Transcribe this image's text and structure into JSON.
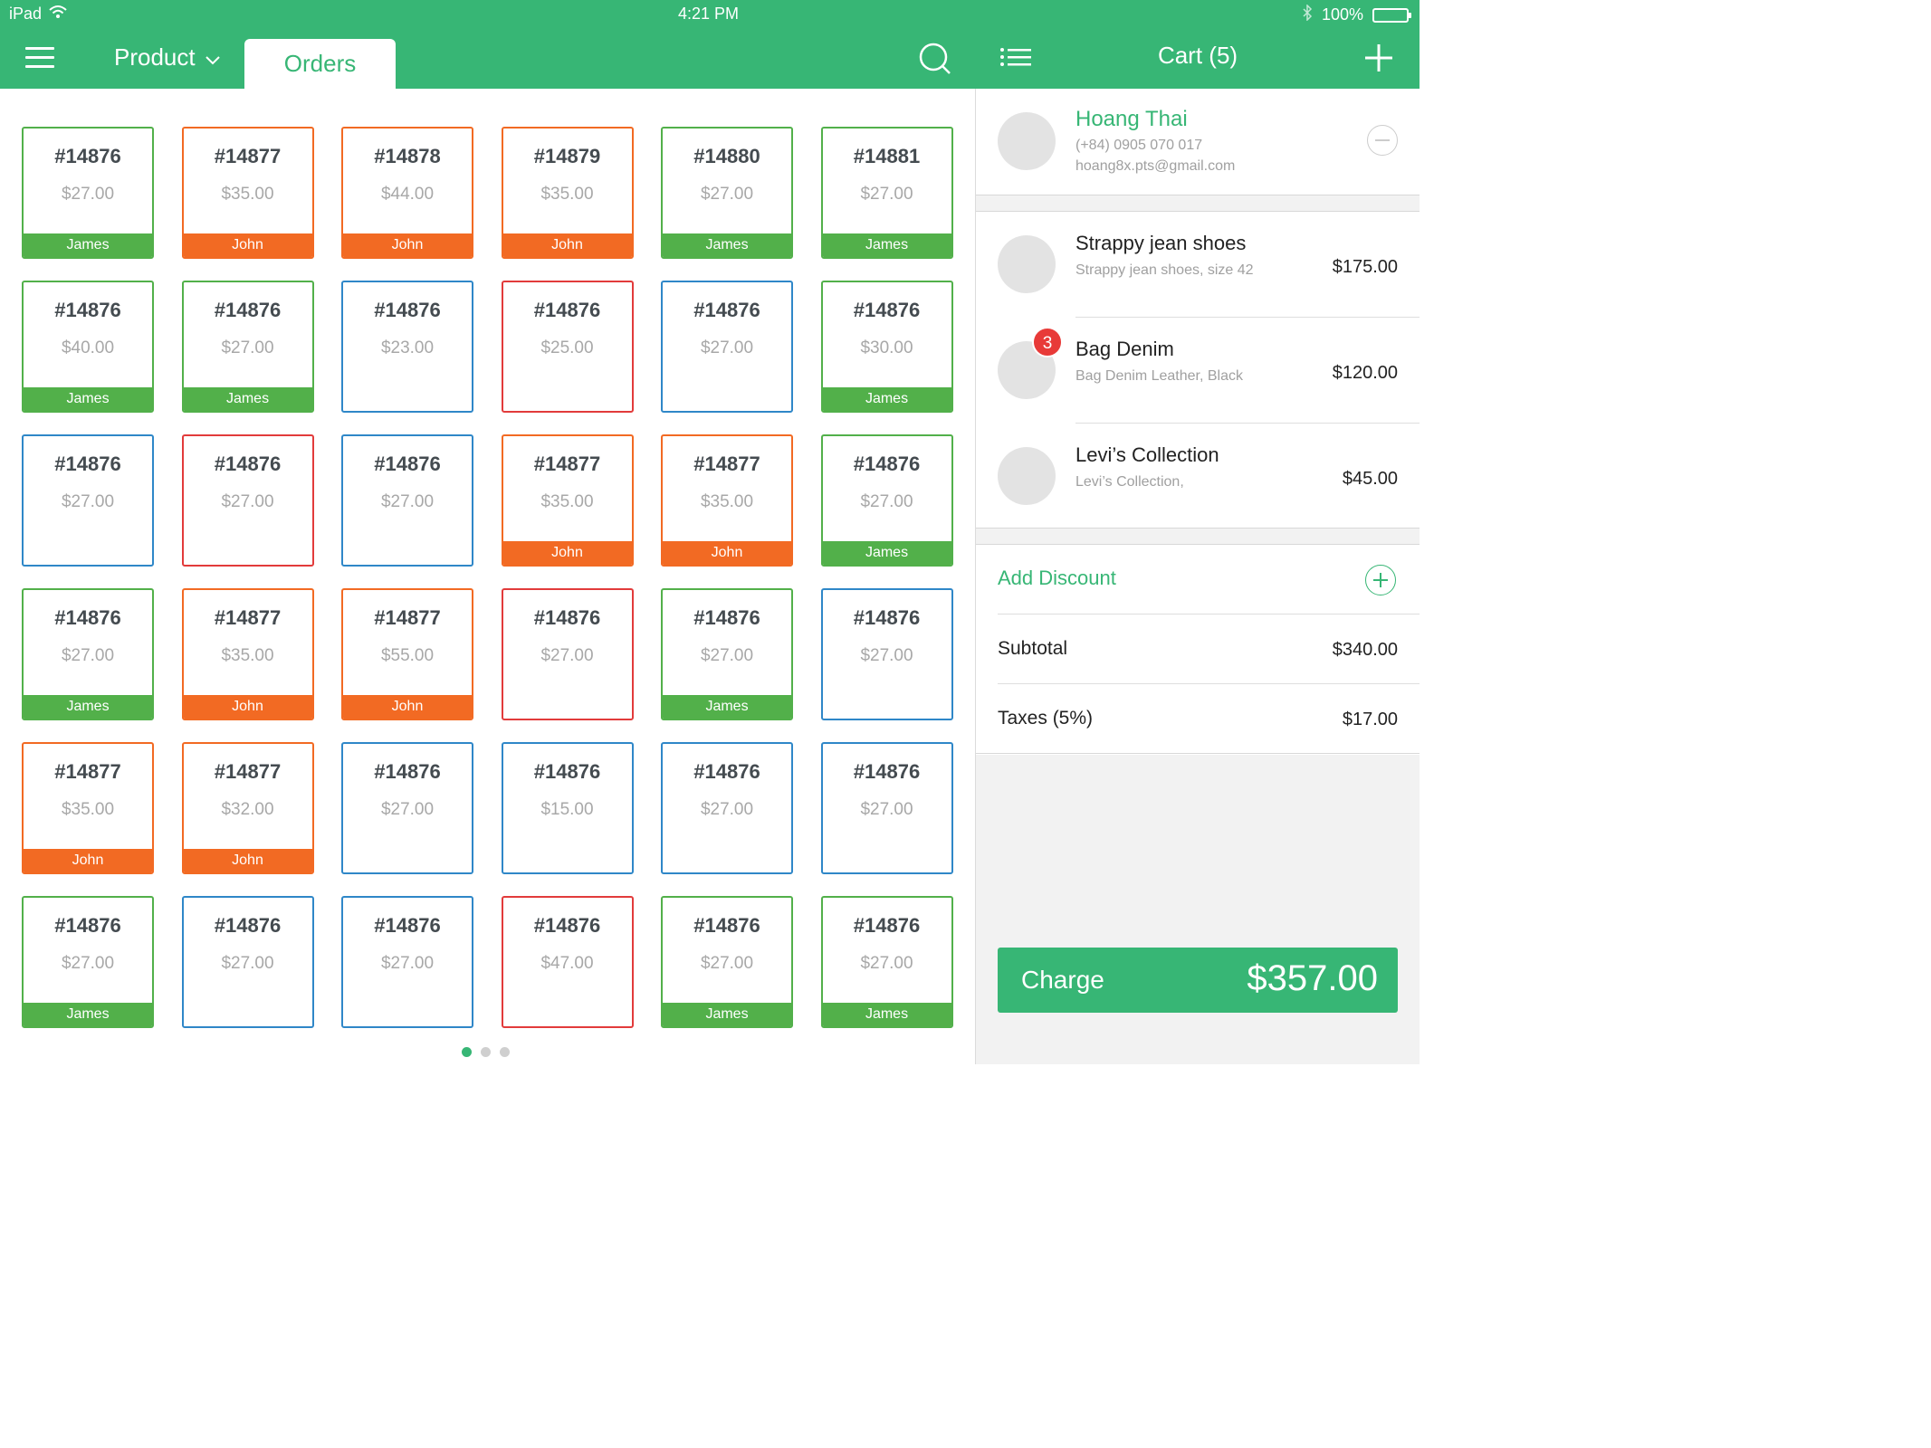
{
  "status_bar": {
    "device": "iPad",
    "time": "4:21 PM",
    "battery": "100%"
  },
  "header": {
    "product_label": "Product",
    "orders_label": "Orders"
  },
  "colors": {
    "green": "#52b04a",
    "orange": "#f26a23",
    "blue": "#2f87c8",
    "red": "#e23b3b",
    "brand": "#37b675"
  },
  "orders": [
    {
      "id": "#14876",
      "price": "$27.00",
      "owner": "James",
      "color": "green"
    },
    {
      "id": "#14877",
      "price": "$35.00",
      "owner": "John",
      "color": "orange"
    },
    {
      "id": "#14878",
      "price": "$44.00",
      "owner": "John",
      "color": "orange"
    },
    {
      "id": "#14879",
      "price": "$35.00",
      "owner": "John",
      "color": "orange"
    },
    {
      "id": "#14880",
      "price": "$27.00",
      "owner": "James",
      "color": "green"
    },
    {
      "id": "#14881",
      "price": "$27.00",
      "owner": "James",
      "color": "green"
    },
    {
      "id": "#14876",
      "price": "$40.00",
      "owner": "James",
      "color": "green"
    },
    {
      "id": "#14876",
      "price": "$27.00",
      "owner": "James",
      "color": "green"
    },
    {
      "id": "#14876",
      "price": "$23.00",
      "owner": "",
      "color": "blue"
    },
    {
      "id": "#14876",
      "price": "$25.00",
      "owner": "",
      "color": "red"
    },
    {
      "id": "#14876",
      "price": "$27.00",
      "owner": "",
      "color": "blue"
    },
    {
      "id": "#14876",
      "price": "$30.00",
      "owner": "James",
      "color": "green"
    },
    {
      "id": "#14876",
      "price": "$27.00",
      "owner": "",
      "color": "blue"
    },
    {
      "id": "#14876",
      "price": "$27.00",
      "owner": "",
      "color": "red"
    },
    {
      "id": "#14876",
      "price": "$27.00",
      "owner": "",
      "color": "blue"
    },
    {
      "id": "#14877",
      "price": "$35.00",
      "owner": "John",
      "color": "orange"
    },
    {
      "id": "#14877",
      "price": "$35.00",
      "owner": "John",
      "color": "orange"
    },
    {
      "id": "#14876",
      "price": "$27.00",
      "owner": "James",
      "color": "green"
    },
    {
      "id": "#14876",
      "price": "$27.00",
      "owner": "James",
      "color": "green"
    },
    {
      "id": "#14877",
      "price": "$35.00",
      "owner": "John",
      "color": "orange"
    },
    {
      "id": "#14877",
      "price": "$55.00",
      "owner": "John",
      "color": "orange"
    },
    {
      "id": "#14876",
      "price": "$27.00",
      "owner": "",
      "color": "red"
    },
    {
      "id": "#14876",
      "price": "$27.00",
      "owner": "James",
      "color": "green"
    },
    {
      "id": "#14876",
      "price": "$27.00",
      "owner": "",
      "color": "blue"
    },
    {
      "id": "#14877",
      "price": "$35.00",
      "owner": "John",
      "color": "orange"
    },
    {
      "id": "#14877",
      "price": "$32.00",
      "owner": "John",
      "color": "orange"
    },
    {
      "id": "#14876",
      "price": "$27.00",
      "owner": "",
      "color": "blue"
    },
    {
      "id": "#14876",
      "price": "$15.00",
      "owner": "",
      "color": "blue"
    },
    {
      "id": "#14876",
      "price": "$27.00",
      "owner": "",
      "color": "blue"
    },
    {
      "id": "#14876",
      "price": "$27.00",
      "owner": "",
      "color": "blue"
    },
    {
      "id": "#14876",
      "price": "$27.00",
      "owner": "James",
      "color": "green"
    },
    {
      "id": "#14876",
      "price": "$27.00",
      "owner": "",
      "color": "blue"
    },
    {
      "id": "#14876",
      "price": "$27.00",
      "owner": "",
      "color": "blue"
    },
    {
      "id": "#14876",
      "price": "$47.00",
      "owner": "",
      "color": "red"
    },
    {
      "id": "#14876",
      "price": "$27.00",
      "owner": "James",
      "color": "green"
    },
    {
      "id": "#14876",
      "price": "$27.00",
      "owner": "James",
      "color": "green"
    }
  ],
  "pagination": {
    "pages": 3,
    "active": 0
  },
  "cart": {
    "title": "Cart (5)",
    "customer": {
      "name": "Hoang Thai",
      "phone": "(+84) 0905 070 017",
      "email": "hoang8x.pts@gmail.com"
    },
    "items": [
      {
        "name": "Strappy jean shoes",
        "desc": "Strappy jean shoes, size 42",
        "price": "$175.00",
        "badge": ""
      },
      {
        "name": "Bag Denim",
        "desc": "Bag Denim Leather, Black",
        "price": "$120.00",
        "badge": "3"
      },
      {
        "name": "Levi’s Collection",
        "desc": "Levi’s Collection,",
        "price": "$45.00",
        "badge": ""
      }
    ],
    "add_discount": "Add Discount",
    "subtotal_label": "Subtotal",
    "subtotal": "$340.00",
    "taxes_label": "Taxes (5%)",
    "taxes": "$17.00",
    "charge_label": "Charge",
    "charge_amount": "$357.00"
  }
}
